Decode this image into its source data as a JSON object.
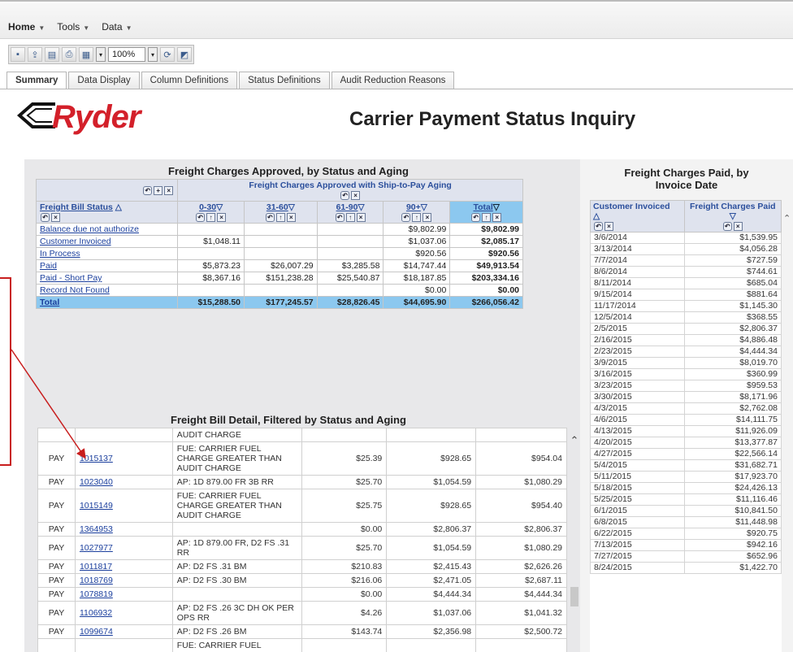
{
  "menu": {
    "items": [
      "Home",
      "Tools",
      "Data"
    ]
  },
  "toolbar": {
    "zoom": "100%"
  },
  "tabs": [
    "Summary",
    "Data Display",
    "Column Definitions",
    "Status Definitions",
    "Audit Reduction Reasons"
  ],
  "brand": {
    "logo_text": "Ryder",
    "logo_color": "#d3202a"
  },
  "page_title": "Carrier Payment Status Inquiry",
  "approved": {
    "title": "Freight Charges Approved, by Status and Aging",
    "group_header": "Freight Charges Approved with Ship-to-Pay Aging",
    "status_header": "Freight Bill Status",
    "columns": [
      "0-30",
      "31-60",
      "61-90",
      "90+",
      "Total"
    ],
    "rows": [
      {
        "status": "Balance due not authorize",
        "values": [
          "",
          "",
          "",
          "$9,802.99",
          "$9,802.99"
        ]
      },
      {
        "status": "Customer Invoiced",
        "values": [
          "$1,048.11",
          "",
          "",
          "$1,037.06",
          "$2,085.17"
        ]
      },
      {
        "status": "In Process",
        "values": [
          "",
          "",
          "",
          "$920.56",
          "$920.56"
        ]
      },
      {
        "status": "Paid",
        "values": [
          "$5,873.23",
          "$26,007.29",
          "$3,285.58",
          "$14,747.44",
          "$49,913.54"
        ]
      },
      {
        "status": "Paid - Short Pay",
        "values": [
          "$8,367.16",
          "$151,238.28",
          "$25,540.87",
          "$18,187.85",
          "$203,334.16"
        ]
      },
      {
        "status": "Record Not Found",
        "values": [
          "",
          "",
          "",
          "$0.00",
          "$0.00"
        ]
      }
    ],
    "total": {
      "status": "Total",
      "values": [
        "$15,288.50",
        "$177,245.57",
        "$28,826.45",
        "$44,695.90",
        "$266,056.42"
      ]
    }
  },
  "detail": {
    "title": "Freight Bill Detail, Filtered by Status and Aging",
    "rows": [
      {
        "status": "",
        "bill": "",
        "reason": "AUDIT CHARGE",
        "c1": "",
        "c2": "",
        "c3": ""
      },
      {
        "status": "PAY",
        "bill": "1015137",
        "reason": "FUE: CARRIER FUEL CHARGE GREATER THAN AUDIT CHARGE",
        "c1": "$25.39",
        "c2": "$928.65",
        "c3": "$954.04"
      },
      {
        "status": "PAY",
        "bill": "1023040",
        "reason": "AP: 1D 879.00 FR 3B RR",
        "c1": "$25.70",
        "c2": "$1,054.59",
        "c3": "$1,080.29"
      },
      {
        "status": "PAY",
        "bill": "1015149",
        "reason": "FUE: CARRIER FUEL CHARGE GREATER THAN AUDIT CHARGE",
        "c1": "$25.75",
        "c2": "$928.65",
        "c3": "$954.40"
      },
      {
        "status": "PAY",
        "bill": "1364953",
        "reason": "",
        "c1": "$0.00",
        "c2": "$2,806.37",
        "c3": "$2,806.37"
      },
      {
        "status": "PAY",
        "bill": "1027977",
        "reason": "AP: 1D 879.00 FR, D2 FS .31 RR",
        "c1": "$25.70",
        "c2": "$1,054.59",
        "c3": "$1,080.29"
      },
      {
        "status": "PAY",
        "bill": "1011817",
        "reason": "AP: D2 FS .31 BM",
        "c1": "$210.83",
        "c2": "$2,415.43",
        "c3": "$2,626.26"
      },
      {
        "status": "PAY",
        "bill": "1018769",
        "reason": "AP: D2 FS .30 BM",
        "c1": "$216.06",
        "c2": "$2,471.05",
        "c3": "$2,687.11"
      },
      {
        "status": "PAY",
        "bill": "1078819",
        "reason": "",
        "c1": "$0.00",
        "c2": "$4,444.34",
        "c3": "$4,444.34"
      },
      {
        "status": "PAY",
        "bill": "1106932",
        "reason": "AP: D2 FS .26 3C DH OK PER OPS RR",
        "c1": "$4.26",
        "c2": "$1,037.06",
        "c3": "$1,041.32"
      },
      {
        "status": "PAY",
        "bill": "1099674",
        "reason": "AP: D2 FS .26 BM",
        "c1": "$143.74",
        "c2": "$2,356.98",
        "c3": "$2,500.72"
      },
      {
        "status": "",
        "bill": "",
        "reason": "FUE: CARRIER FUEL",
        "c1": "",
        "c2": "",
        "c3": ""
      }
    ]
  },
  "paid": {
    "title_line1": "Freight Charges Paid, by",
    "title_line2": "Invoice Date",
    "col1": "Customer Invoiced",
    "col2": "Freight Charges Paid",
    "rows": [
      [
        "3/6/2014",
        "$1,539.95"
      ],
      [
        "3/13/2014",
        "$4,056.28"
      ],
      [
        "7/7/2014",
        "$727.59"
      ],
      [
        "8/6/2014",
        "$744.61"
      ],
      [
        "8/11/2014",
        "$685.04"
      ],
      [
        "9/15/2014",
        "$881.64"
      ],
      [
        "11/17/2014",
        "$1,145.30"
      ],
      [
        "12/5/2014",
        "$368.55"
      ],
      [
        "2/5/2015",
        "$2,806.37"
      ],
      [
        "2/16/2015",
        "$4,886.48"
      ],
      [
        "2/23/2015",
        "$4,444.34"
      ],
      [
        "3/9/2015",
        "$8,019.70"
      ],
      [
        "3/16/2015",
        "$360.99"
      ],
      [
        "3/23/2015",
        "$959.53"
      ],
      [
        "3/30/2015",
        "$8,171.96"
      ],
      [
        "4/3/2015",
        "$2,762.08"
      ],
      [
        "4/6/2015",
        "$14,111.75"
      ],
      [
        "4/13/2015",
        "$11,926.09"
      ],
      [
        "4/20/2015",
        "$13,377.87"
      ],
      [
        "4/27/2015",
        "$22,566.14"
      ],
      [
        "5/4/2015",
        "$31,682.71"
      ],
      [
        "5/11/2015",
        "$17,923.70"
      ],
      [
        "5/18/2015",
        "$24,426.13"
      ],
      [
        "5/25/2015",
        "$11,116.46"
      ],
      [
        "6/1/2015",
        "$10,841.50"
      ],
      [
        "6/8/2015",
        "$11,448.98"
      ],
      [
        "6/22/2015",
        "$920.75"
      ],
      [
        "7/13/2015",
        "$942.16"
      ],
      [
        "7/27/2015",
        "$652.96"
      ],
      [
        "8/24/2015",
        "$1,422.70"
      ]
    ]
  }
}
